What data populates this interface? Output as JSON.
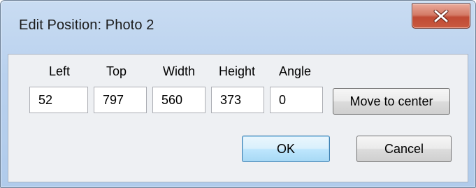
{
  "dialog": {
    "title": "Edit Position: Photo 2"
  },
  "fields": {
    "left": {
      "label": "Left",
      "value": "52"
    },
    "top": {
      "label": "Top",
      "value": "797"
    },
    "width": {
      "label": "Width",
      "value": "560"
    },
    "height": {
      "label": "Height",
      "value": "373"
    },
    "angle": {
      "label": "Angle",
      "value": "0"
    }
  },
  "buttons": {
    "move_to_center": "Move to center",
    "ok": "OK",
    "cancel": "Cancel"
  },
  "icons": {
    "close": "close-icon"
  }
}
